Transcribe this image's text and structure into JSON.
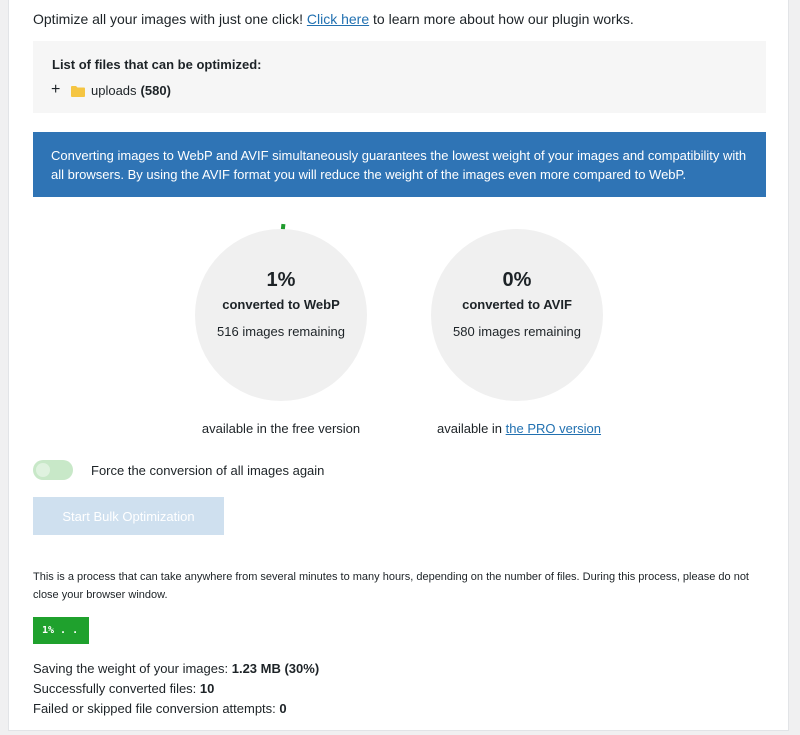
{
  "intro": {
    "text_before": "Optimize all your images with just one click! ",
    "link_text": "Click here",
    "text_after": " to learn more about how our plugin works."
  },
  "files": {
    "title": "List of files that can be optimized:",
    "expand_symbol": "+",
    "folder_name": "uploads",
    "folder_count": "(580)"
  },
  "info_banner": {
    "text": "Converting images to WebP and AVIF simultaneously guarantees the lowest weight of your images and compatibility with all browsers. By using the AVIF format you will reduce the weight of the images even more compared to WebP."
  },
  "gauges": {
    "webp": {
      "percent": "1%",
      "label": "converted to WebP",
      "remaining": "516 images remaining",
      "progress": 0.01
    },
    "avif": {
      "percent": "0%",
      "label": "converted to AVIF",
      "remaining": "580 images remaining",
      "progress": 0
    }
  },
  "availability": {
    "free": "available in the free version",
    "pro_prefix": "available in ",
    "pro_link": "the PRO version"
  },
  "force_toggle": {
    "label": "Force the conversion of all images again",
    "state": "off"
  },
  "bulk_button": {
    "label": "Start Bulk Optimization"
  },
  "note": "This is a process that can take anywhere from several minutes to many hours, depending on the number of files. During this process, please do not close your browser window.",
  "progress_box": {
    "text": "1% . ."
  },
  "stats": {
    "saving_label": "Saving the weight of your images: ",
    "saving_value": "1.23 MB (30%)",
    "converted_label": "Successfully converted files: ",
    "converted_value": "10",
    "failed_label": "Failed or skipped file conversion attempts: ",
    "failed_value": "0"
  },
  "colors": {
    "banner_bg": "#2f74b5",
    "progress_green": "#1fa12d",
    "link_blue": "#2271b1",
    "folder_yellow": "#f5c542",
    "toggle_bg": "#c8e8c8",
    "button_bg": "#cfe0ef"
  }
}
